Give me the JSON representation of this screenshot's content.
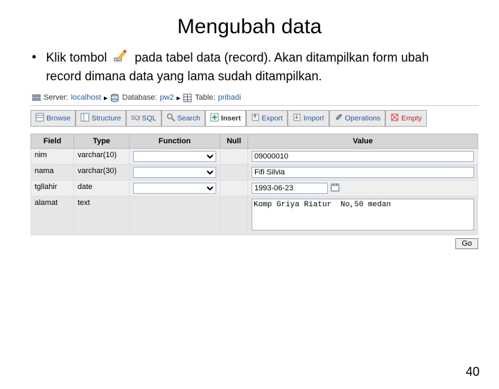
{
  "slide": {
    "title": "Mengubah data",
    "bullet_pre": "Klik tombol",
    "bullet_post": "pada tabel data (record). Akan ditampilkan form ubah record dimana data yang lama sudah ditampilkan.",
    "page_number": "40"
  },
  "breadcrumb": {
    "server_label": "Server:",
    "server_value": "localhost",
    "db_label": "Database:",
    "db_value": "pw2",
    "table_label": "Table:",
    "table_value": "pribadi"
  },
  "tabs": {
    "browse": "Browse",
    "structure": "Structure",
    "sql": "SQL",
    "search": "Search",
    "insert": "Insert",
    "export": "Export",
    "import": "Import",
    "operations": "Operations",
    "empty": "Empty"
  },
  "grid": {
    "headers": {
      "field": "Field",
      "type": "Type",
      "function": "Function",
      "null": "Null",
      "value": "Value"
    },
    "rows": [
      {
        "field": "nim",
        "type": "varchar(10)",
        "value": "09000010"
      },
      {
        "field": "nama",
        "type": "varchar(30)",
        "value": "Fifi Silvia"
      },
      {
        "field": "tgllahir",
        "type": "date",
        "value": "1993-06-23"
      },
      {
        "field": "alamat",
        "type": "text",
        "value": "Komp Griya Riatur  No,50 medan"
      }
    ]
  },
  "go_label": "Go"
}
